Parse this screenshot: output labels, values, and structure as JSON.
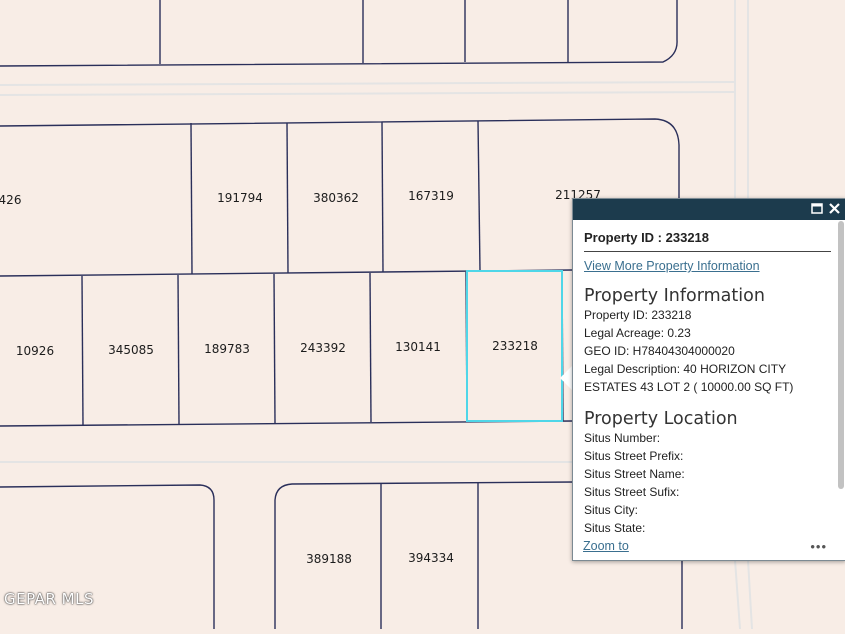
{
  "map": {
    "watermark": "GEPAR MLS",
    "colors": {
      "background": "#f8ede6",
      "parcel_line": "#2a2f5a",
      "road_line": "#e6e6e6",
      "selection": "#4fd6e8"
    },
    "parcels": [
      {
        "id": "426"
      },
      {
        "id": "191794"
      },
      {
        "id": "380362"
      },
      {
        "id": "167319"
      },
      {
        "id": "211257"
      },
      {
        "id": "10926"
      },
      {
        "id": "345085"
      },
      {
        "id": "189783"
      },
      {
        "id": "243392"
      },
      {
        "id": "130141"
      },
      {
        "id": "233218",
        "selected": true
      },
      {
        "id": "389188"
      },
      {
        "id": "394334"
      }
    ]
  },
  "popup": {
    "header_icons": [
      "maximize-icon",
      "close-icon"
    ],
    "property_id_label": "Property ID :",
    "property_id_value": "233218",
    "view_more_link": "View More Property Information",
    "property_information": {
      "title": "Property Information",
      "rows": [
        "Property ID: 233218",
        "Legal Acreage: 0.23",
        "GEO ID: H78404304000020",
        "Legal Description: 40 HORIZON CITY ESTATES 43 LOT 2 ( 10000.00 SQ FT)"
      ]
    },
    "property_location": {
      "title": "Property Location",
      "rows": [
        "Situs Number:",
        "Situs Street Prefix:",
        "Situs Street Name:",
        "Situs Street Sufix:",
        "Situs City:",
        "Situs State:"
      ]
    },
    "zoom_link": "Zoom to",
    "more_menu": "•••"
  }
}
